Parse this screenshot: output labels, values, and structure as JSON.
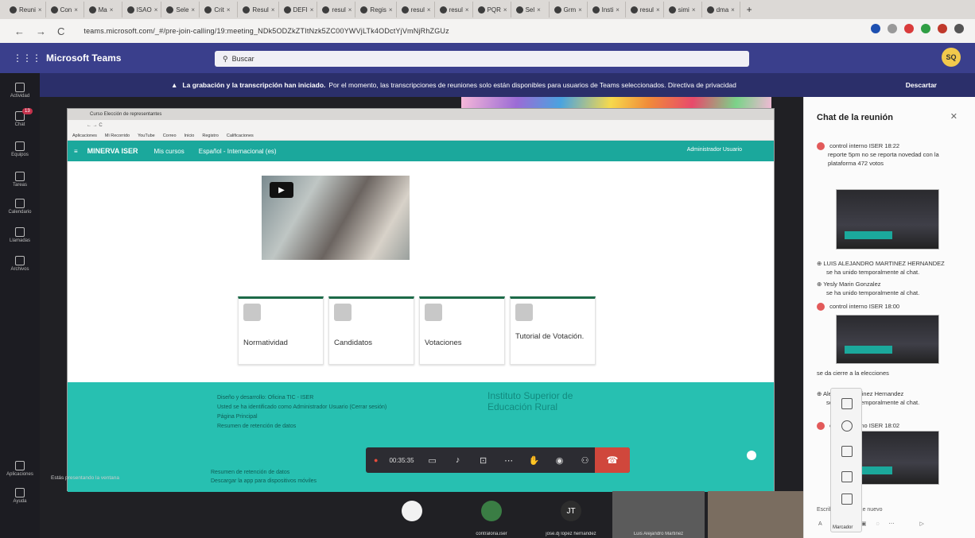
{
  "browser": {
    "tabs": [
      "Reuni",
      "Con",
      "Ma",
      "ISAO",
      "Sele",
      "Crit",
      "Resul",
      "DEFI",
      "resul",
      "Regis",
      "resul",
      "resul",
      "PQR",
      "Sel",
      "Grm",
      "Insti",
      "resul",
      "simi",
      "dma"
    ],
    "new_tab": "+",
    "url": "teams.microsoft.com/_#/pre-join-calling/19:meeting_NDk5ODZkZTItNzk5ZC00YWVjLTk4ODctYjVmNjRhZGUz",
    "nav": {
      "back": "←",
      "forward": "→",
      "reload": "C"
    }
  },
  "teams": {
    "title": "Microsoft Teams",
    "search_placeholder": "Buscar",
    "user_initials": "SQ",
    "banner_bold": "La grabación y la transcripción han iniciado.",
    "banner_text": "Por el momento, las transcripciones de reuniones solo están disponibles para usuarios de Teams seleccionados. Directiva de privacidad",
    "banner_dismiss": "Descartar",
    "rail": [
      {
        "label": "Actividad",
        "icon": "bell-icon"
      },
      {
        "label": "Chat",
        "icon": "chat-icon",
        "badge": "13"
      },
      {
        "label": "Equipos",
        "icon": "teams-icon"
      },
      {
        "label": "Tareas",
        "icon": "tasks-icon"
      },
      {
        "label": "Calendario",
        "icon": "calendar-icon"
      },
      {
        "label": "Llamadas",
        "icon": "phone-icon"
      },
      {
        "label": "Archivos",
        "icon": "files-icon"
      },
      {
        "label": "Aplicaciones",
        "icon": "apps-icon"
      },
      {
        "label": "Ayuda",
        "icon": "help-icon"
      }
    ],
    "presenter_label": "Estás presentando la ventana"
  },
  "shared_screen": {
    "tab_label": "Curso Elección de representantes",
    "bookmarks": [
      "Aplicaciones",
      "Mi Recorrido",
      "YouTube",
      "Correo",
      "Inicio",
      "Registro",
      "Calificaciones"
    ],
    "site_brand": "MINERVA ISER",
    "site_menu": [
      "Mis cursos",
      "Español - Internacional (es)"
    ],
    "site_user": "Administrador Usuario",
    "cards": [
      "Normatividad",
      "Candidatos",
      "Votaciones",
      "Tutorial de Votación."
    ],
    "footer_left": [
      "Diseño y desarrollo: Oficina TIC - ISER",
      "Usted se ha identificado como Administrador Usuario (Cerrar sesión)",
      "Página Principal",
      "Resumen de retención de datos"
    ],
    "footer_right": [
      "Instituto Superior de",
      "Educación Rural"
    ],
    "footer_bottom": [
      "Resumen de retención de datos",
      "Descargar la app para dispositivos móviles"
    ]
  },
  "call": {
    "timer": "00:35:35",
    "hangup_icon": "phone-down-icon"
  },
  "participants": [
    {
      "name": "",
      "initials": "",
      "color": "#f2f2f2"
    },
    {
      "name": "contraloria.iser",
      "initials": "",
      "color": "#3a7d44"
    },
    {
      "name": "jose.dj lopez hernandez",
      "initials": "JT",
      "color": "#2d2d2d"
    },
    {
      "name": "Luis Alejandro Martinez",
      "initials": "",
      "color": "#5b5b5b"
    },
    {
      "name": "",
      "initials": "",
      "color": "#7a6d60"
    }
  ],
  "chat": {
    "title": "Chat de la reunión",
    "messages": [
      {
        "author": "control interno ISER",
        "time": "18:22",
        "text": "reporte 5pm no se reporta novedad con la plataforma 472 votos"
      },
      {
        "author": "LUIS ALEJANDRO MARTINEZ HERNANDEZ",
        "time": "",
        "text": "se ha unido temporalmente al chat."
      },
      {
        "author": "Yesly Marin Gonzalez",
        "time": "",
        "text": "se ha unido temporalmente al chat."
      },
      {
        "author": "control interno ISER",
        "time": "18:00",
        "text": "se da cierre a la elecciones"
      },
      {
        "author": "Alejandro Martinez Hernandez",
        "time": "",
        "text": "se ha unido temporalmente al chat."
      },
      {
        "author": "control interno ISER",
        "time": "18:02",
        "text": ""
      }
    ],
    "compose_placeholder": "Escribir un mensaje nuevo",
    "toolbox_label": "Marcador"
  }
}
